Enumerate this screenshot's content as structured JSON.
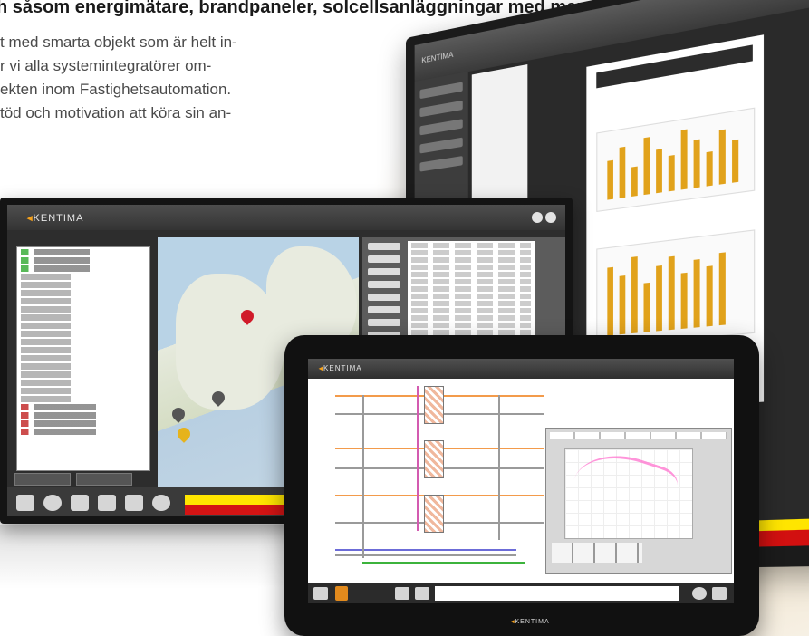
{
  "text": {
    "headline": "h såsom energimätare, brandpaneler, solcellsanläggningar med mera.",
    "intro_lines": [
      "t med smarta objekt som är helt in-",
      "r vi alla systemintegratörer om-",
      "ekten inom Fastighetsautomation.",
      "töd och motivation att köra sin an-"
    ]
  },
  "screens": {
    "mid": {
      "brand_mark": "◂",
      "brand": "KENTIMA"
    },
    "tablet": {
      "brand_mark": "◂",
      "brand": "KENTIMA",
      "footer_brand": "KENTIMA"
    },
    "monitor": {
      "brand": "KENTIMA"
    }
  },
  "colors": {
    "accent": "#f4a11d",
    "alarm_yellow": "#ffe600",
    "alarm_red": "#d41414",
    "chart_bar": "#e1a21b"
  }
}
